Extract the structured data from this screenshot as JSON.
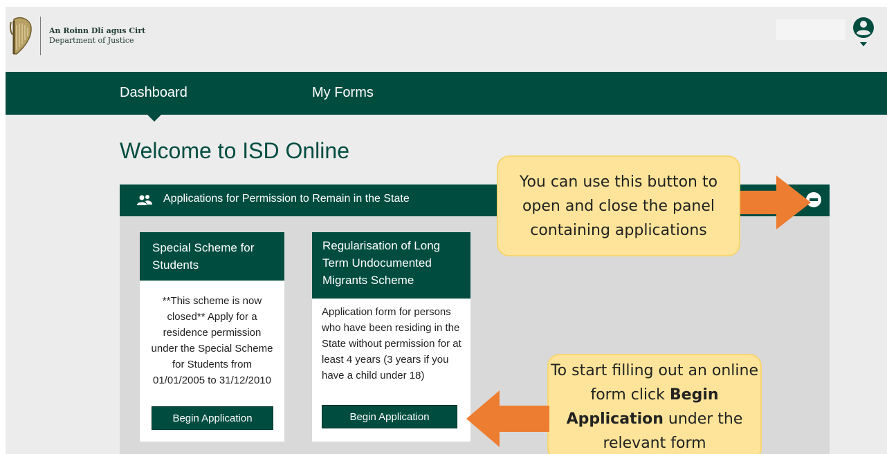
{
  "header": {
    "logo_line1": "An Roinn Dlí agus Cirt",
    "logo_line2": "Department of Justice",
    "user_icon": "user-account-icon"
  },
  "nav": {
    "items": [
      {
        "label": "Dashboard"
      },
      {
        "label": "My Forms"
      }
    ]
  },
  "main": {
    "welcome": "Welcome to ISD Online",
    "panel": {
      "icon": "group-icon",
      "title": "Applications for Permission to Remain in the State",
      "toggle_icon": "minus-circle-icon"
    },
    "cards": [
      {
        "title": "Special Scheme for Students",
        "description": "**This scheme is now closed** Apply for a residence permission under the Special Scheme for Students from 01/01/2005 to 31/12/2010",
        "button": "Begin Application"
      },
      {
        "title": "Regularisation of Long Term Undocumented Migrants Scheme",
        "description": "Application form for persons who have been residing in the State without permission for at least 4 years (3 years if you have a child under 18)",
        "button": "Begin Application"
      }
    ]
  },
  "callouts": {
    "toggle_text": "You can use this button to open and close the panel containing applications",
    "begin_pre": "To start filling out an online form click ",
    "begin_bold": "Begin Application",
    "begin_post": " under the relevant form"
  },
  "colors": {
    "brand": "#004d40",
    "callout": "#fde49a",
    "arrow": "#ed7d31",
    "page_bg": "#ececec",
    "panel_bg": "#d9d9d9"
  }
}
